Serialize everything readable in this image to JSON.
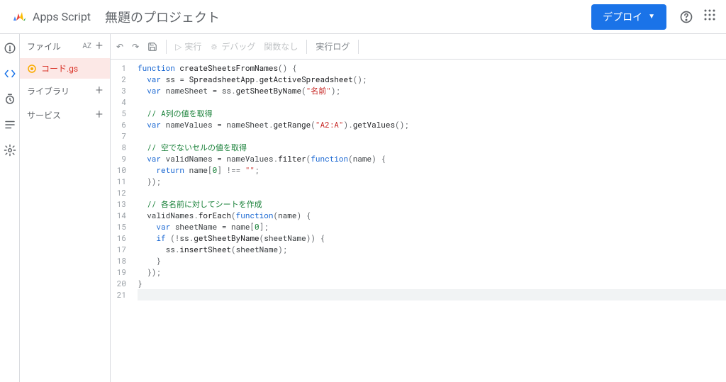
{
  "header": {
    "product": "Apps Script",
    "title": "無題のプロジェクト",
    "deploy": "デプロイ"
  },
  "panel": {
    "files_label": "ファイル",
    "sort": "AZ",
    "libraries_label": "ライブラリ",
    "services_label": "サービス",
    "file_name": "コード.gs"
  },
  "toolbar": {
    "run": "実行",
    "debug": "デバッグ",
    "func": "関数なし",
    "log": "実行ログ"
  },
  "code": {
    "lines": [
      [
        {
          "c": "kw",
          "t": "function"
        },
        {
          "c": "",
          "t": " "
        },
        {
          "c": "fn",
          "t": "createSheetsFromNames"
        },
        {
          "c": "pun",
          "t": "()"
        },
        {
          "c": "",
          "t": " "
        },
        {
          "c": "pun",
          "t": "{"
        }
      ],
      [
        {
          "c": "",
          "t": "  "
        },
        {
          "c": "kw",
          "t": "var"
        },
        {
          "c": "",
          "t": " ss = "
        },
        {
          "c": "cls",
          "t": "SpreadsheetApp"
        },
        {
          "c": "pun",
          "t": "."
        },
        {
          "c": "fn",
          "t": "getActiveSpreadsheet"
        },
        {
          "c": "pun",
          "t": "();"
        }
      ],
      [
        {
          "c": "",
          "t": "  "
        },
        {
          "c": "kw",
          "t": "var"
        },
        {
          "c": "",
          "t": " nameSheet = ss"
        },
        {
          "c": "pun",
          "t": "."
        },
        {
          "c": "fn",
          "t": "getSheetByName"
        },
        {
          "c": "pun",
          "t": "("
        },
        {
          "c": "str",
          "t": "\"名前\""
        },
        {
          "c": "pun",
          "t": ");"
        }
      ],
      [
        {
          "c": "",
          "t": "  "
        }
      ],
      [
        {
          "c": "",
          "t": "  "
        },
        {
          "c": "com",
          "t": "// A列の値を取得"
        }
      ],
      [
        {
          "c": "",
          "t": "  "
        },
        {
          "c": "kw",
          "t": "var"
        },
        {
          "c": "",
          "t": " nameValues = nameSheet"
        },
        {
          "c": "pun",
          "t": "."
        },
        {
          "c": "fn",
          "t": "getRange"
        },
        {
          "c": "pun",
          "t": "("
        },
        {
          "c": "str",
          "t": "\"A2:A\""
        },
        {
          "c": "pun",
          "t": ")."
        },
        {
          "c": "fn",
          "t": "getValues"
        },
        {
          "c": "pun",
          "t": "();"
        }
      ],
      [
        {
          "c": "",
          "t": "  "
        }
      ],
      [
        {
          "c": "",
          "t": "  "
        },
        {
          "c": "com",
          "t": "// 空でないセルの値を取得"
        }
      ],
      [
        {
          "c": "",
          "t": "  "
        },
        {
          "c": "kw",
          "t": "var"
        },
        {
          "c": "",
          "t": " validNames = nameValues"
        },
        {
          "c": "pun",
          "t": "."
        },
        {
          "c": "fn",
          "t": "filter"
        },
        {
          "c": "pun",
          "t": "("
        },
        {
          "c": "kw",
          "t": "function"
        },
        {
          "c": "pun",
          "t": "("
        },
        {
          "c": "",
          "t": "name"
        },
        {
          "c": "pun",
          "t": ")"
        },
        {
          "c": "",
          "t": " "
        },
        {
          "c": "pun",
          "t": "{"
        }
      ],
      [
        {
          "c": "",
          "t": "    "
        },
        {
          "c": "kw",
          "t": "return"
        },
        {
          "c": "",
          "t": " name"
        },
        {
          "c": "pun",
          "t": "["
        },
        {
          "c": "num",
          "t": "0"
        },
        {
          "c": "pun",
          "t": "]"
        },
        {
          "c": "",
          "t": " "
        },
        {
          "c": "op",
          "t": "!=="
        },
        {
          "c": "",
          "t": " "
        },
        {
          "c": "str",
          "t": "\"\""
        },
        {
          "c": "pun",
          "t": ";"
        }
      ],
      [
        {
          "c": "",
          "t": "  "
        },
        {
          "c": "pun",
          "t": "});"
        }
      ],
      [
        {
          "c": "",
          "t": "  "
        }
      ],
      [
        {
          "c": "",
          "t": "  "
        },
        {
          "c": "com",
          "t": "// 各名前に対してシートを作成"
        }
      ],
      [
        {
          "c": "",
          "t": "  validNames"
        },
        {
          "c": "pun",
          "t": "."
        },
        {
          "c": "fn",
          "t": "forEach"
        },
        {
          "c": "pun",
          "t": "("
        },
        {
          "c": "kw",
          "t": "function"
        },
        {
          "c": "pun",
          "t": "("
        },
        {
          "c": "",
          "t": "name"
        },
        {
          "c": "pun",
          "t": ")"
        },
        {
          "c": "",
          "t": " "
        },
        {
          "c": "pun",
          "t": "{"
        }
      ],
      [
        {
          "c": "",
          "t": "    "
        },
        {
          "c": "kw",
          "t": "var"
        },
        {
          "c": "",
          "t": " sheetName = name"
        },
        {
          "c": "pun",
          "t": "["
        },
        {
          "c": "num",
          "t": "0"
        },
        {
          "c": "pun",
          "t": "];"
        }
      ],
      [
        {
          "c": "",
          "t": "    "
        },
        {
          "c": "kw",
          "t": "if"
        },
        {
          "c": "",
          "t": " "
        },
        {
          "c": "pun",
          "t": "(!"
        },
        {
          "c": "",
          "t": "ss"
        },
        {
          "c": "pun",
          "t": "."
        },
        {
          "c": "fn",
          "t": "getSheetByName"
        },
        {
          "c": "pun",
          "t": "("
        },
        {
          "c": "",
          "t": "sheetName"
        },
        {
          "c": "pun",
          "t": "))"
        },
        {
          "c": "",
          "t": " "
        },
        {
          "c": "pun",
          "t": "{"
        }
      ],
      [
        {
          "c": "",
          "t": "      ss"
        },
        {
          "c": "pun",
          "t": "."
        },
        {
          "c": "fn",
          "t": "insertSheet"
        },
        {
          "c": "pun",
          "t": "("
        },
        {
          "c": "",
          "t": "sheetName"
        },
        {
          "c": "pun",
          "t": ");"
        }
      ],
      [
        {
          "c": "",
          "t": "    "
        },
        {
          "c": "pun",
          "t": "}"
        }
      ],
      [
        {
          "c": "",
          "t": "  "
        },
        {
          "c": "pun",
          "t": "});"
        }
      ],
      [
        {
          "c": "pun",
          "t": "}"
        }
      ],
      [
        {
          "c": "",
          "t": ""
        }
      ]
    ]
  }
}
